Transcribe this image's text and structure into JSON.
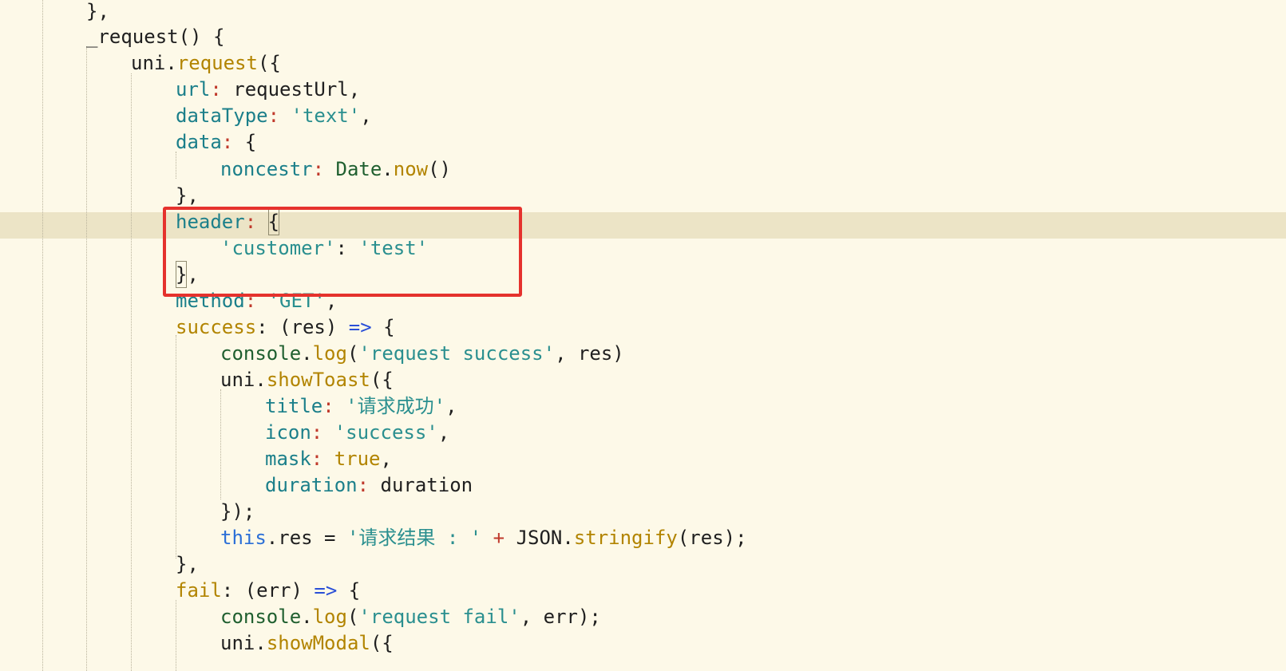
{
  "editor": {
    "current_line_index": 8,
    "lines": [
      [
        {
          "text": "},",
          "cls": "tok-op"
        }
      ],
      [
        {
          "text": "_request",
          "cls": "tok-obj"
        },
        {
          "text": "() {",
          "cls": "tok-op"
        }
      ],
      [
        {
          "text": "uni",
          "cls": "tok-obj"
        },
        {
          "text": ".",
          "cls": "tok-op"
        },
        {
          "text": "request",
          "cls": "tok-fn"
        },
        {
          "text": "({",
          "cls": "tok-op"
        }
      ],
      [
        {
          "text": "url",
          "cls": "tok-prop"
        },
        {
          "text": ":",
          "cls": "tok-red"
        },
        {
          "text": " requestUrl,",
          "cls": "tok-op"
        }
      ],
      [
        {
          "text": "dataType",
          "cls": "tok-prop"
        },
        {
          "text": ":",
          "cls": "tok-red"
        },
        {
          "text": " ",
          "cls": "tok-op"
        },
        {
          "text": "'text'",
          "cls": "tok-str"
        },
        {
          "text": ",",
          "cls": "tok-op"
        }
      ],
      [
        {
          "text": "data",
          "cls": "tok-prop"
        },
        {
          "text": ":",
          "cls": "tok-red"
        },
        {
          "text": " {",
          "cls": "tok-op"
        }
      ],
      [
        {
          "text": "noncestr",
          "cls": "tok-prop"
        },
        {
          "text": ":",
          "cls": "tok-red"
        },
        {
          "text": " ",
          "cls": "tok-op"
        },
        {
          "text": "Date",
          "cls": "tok-green"
        },
        {
          "text": ".",
          "cls": "tok-op"
        },
        {
          "text": "now",
          "cls": "tok-fn"
        },
        {
          "text": "()",
          "cls": "tok-op"
        }
      ],
      [
        {
          "text": "},",
          "cls": "tok-op"
        }
      ],
      [
        {
          "text": "header",
          "cls": "tok-prop"
        },
        {
          "text": ":",
          "cls": "tok-red"
        },
        {
          "text": " ",
          "cls": "tok-op"
        },
        {
          "text": "{",
          "cls": "tok-op cursor-bracket"
        }
      ],
      [
        {
          "text": "'customer'",
          "cls": "tok-str"
        },
        {
          "text": ": ",
          "cls": "tok-op"
        },
        {
          "text": "'test'",
          "cls": "tok-str"
        }
      ],
      [
        {
          "text": "}",
          "cls": "tok-op cursor-bracket"
        },
        {
          "text": ",",
          "cls": "tok-op"
        }
      ],
      [
        {
          "text": "method",
          "cls": "tok-prop"
        },
        {
          "text": ":",
          "cls": "tok-red"
        },
        {
          "text": " ",
          "cls": "tok-op"
        },
        {
          "text": "'GET'",
          "cls": "tok-str"
        },
        {
          "text": ",",
          "cls": "tok-op"
        }
      ],
      [
        {
          "text": "success",
          "cls": "tok-fn"
        },
        {
          "text": ": (res) ",
          "cls": "tok-op"
        },
        {
          "text": "=>",
          "cls": "tok-arrow"
        },
        {
          "text": " {",
          "cls": "tok-op"
        }
      ],
      [
        {
          "text": "console",
          "cls": "tok-green"
        },
        {
          "text": ".",
          "cls": "tok-op"
        },
        {
          "text": "log",
          "cls": "tok-fn"
        },
        {
          "text": "(",
          "cls": "tok-op"
        },
        {
          "text": "'request success'",
          "cls": "tok-str"
        },
        {
          "text": ", res)",
          "cls": "tok-op"
        }
      ],
      [
        {
          "text": "uni",
          "cls": "tok-obj"
        },
        {
          "text": ".",
          "cls": "tok-op"
        },
        {
          "text": "showToast",
          "cls": "tok-fn"
        },
        {
          "text": "({",
          "cls": "tok-op"
        }
      ],
      [
        {
          "text": "title",
          "cls": "tok-prop"
        },
        {
          "text": ":",
          "cls": "tok-red"
        },
        {
          "text": " ",
          "cls": "tok-op"
        },
        {
          "text": "'请求成功'",
          "cls": "tok-str"
        },
        {
          "text": ",",
          "cls": "tok-op"
        }
      ],
      [
        {
          "text": "icon",
          "cls": "tok-prop"
        },
        {
          "text": ":",
          "cls": "tok-red"
        },
        {
          "text": " ",
          "cls": "tok-op"
        },
        {
          "text": "'success'",
          "cls": "tok-str"
        },
        {
          "text": ",",
          "cls": "tok-op"
        }
      ],
      [
        {
          "text": "mask",
          "cls": "tok-prop"
        },
        {
          "text": ":",
          "cls": "tok-red"
        },
        {
          "text": " ",
          "cls": "tok-op"
        },
        {
          "text": "true",
          "cls": "tok-fn"
        },
        {
          "text": ",",
          "cls": "tok-op"
        }
      ],
      [
        {
          "text": "duration",
          "cls": "tok-prop"
        },
        {
          "text": ":",
          "cls": "tok-red"
        },
        {
          "text": " duration",
          "cls": "tok-op"
        }
      ],
      [
        {
          "text": "});",
          "cls": "tok-op"
        }
      ],
      [
        {
          "text": "this",
          "cls": "tok-kw"
        },
        {
          "text": ".res = ",
          "cls": "tok-op"
        },
        {
          "text": "'请求结果 : '",
          "cls": "tok-str"
        },
        {
          "text": " + ",
          "cls": "tok-red"
        },
        {
          "text": "JSON",
          "cls": "tok-obj"
        },
        {
          "text": ".",
          "cls": "tok-op"
        },
        {
          "text": "stringify",
          "cls": "tok-fn"
        },
        {
          "text": "(res);",
          "cls": "tok-op"
        }
      ],
      [
        {
          "text": "},",
          "cls": "tok-op"
        }
      ],
      [
        {
          "text": "fail",
          "cls": "tok-fn"
        },
        {
          "text": ": (err) ",
          "cls": "tok-op"
        },
        {
          "text": "=>",
          "cls": "tok-arrow"
        },
        {
          "text": " {",
          "cls": "tok-op"
        }
      ],
      [
        {
          "text": "console",
          "cls": "tok-green"
        },
        {
          "text": ".",
          "cls": "tok-op"
        },
        {
          "text": "log",
          "cls": "tok-fn"
        },
        {
          "text": "(",
          "cls": "tok-op"
        },
        {
          "text": "'request fail'",
          "cls": "tok-str"
        },
        {
          "text": ", err);",
          "cls": "tok-op"
        }
      ],
      [
        {
          "text": "uni",
          "cls": "tok-obj"
        },
        {
          "text": ".",
          "cls": "tok-op"
        },
        {
          "text": "showModal",
          "cls": "tok-fn"
        },
        {
          "text": "({",
          "cls": "tok-op"
        }
      ]
    ]
  },
  "highlight": {
    "color": "#e5322d",
    "covers_line_indices": [
      8,
      9,
      10
    ]
  }
}
